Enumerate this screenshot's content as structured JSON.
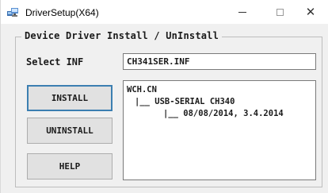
{
  "window": {
    "title": "DriverSetup(X64)",
    "icons": {
      "app": "driver-setup-app-icon",
      "minimize": "minimize-icon",
      "maximize": "maximize-icon",
      "close": "close-icon"
    },
    "close_glyph": "✕"
  },
  "group": {
    "title": "Device Driver Install / UnInstall"
  },
  "inf": {
    "label": "Select INF",
    "value": "CH341SER.INF"
  },
  "buttons": {
    "install": "INSTALL",
    "uninstall": "UNINSTALL",
    "help": "HELP"
  },
  "driver_tree": {
    "vendor": "WCH.CN",
    "device": "|__ USB-SERIAL CH340",
    "version": "|__ 08/08/2014, 3.4.2014"
  },
  "colors": {
    "window_bg": "#f0f0f0",
    "titlebar_bg": "#ffffff",
    "default_button_border": "#3c7fb1"
  }
}
